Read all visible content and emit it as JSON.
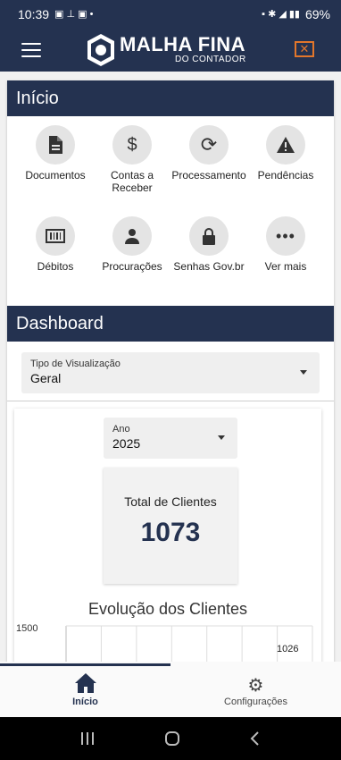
{
  "status_bar": {
    "time": "10:39",
    "battery": "69%"
  },
  "app_bar": {
    "brand_title": "MALHA FINA",
    "brand_subtitle": "DO CONTADOR"
  },
  "inicio": {
    "title": "Início",
    "tiles": [
      {
        "label": "Documentos",
        "icon": "document-icon"
      },
      {
        "label": "Contas a Receber",
        "icon": "dollar-icon"
      },
      {
        "label": "Processamento",
        "icon": "sync-icon"
      },
      {
        "label": "Pendências",
        "icon": "warning-icon"
      },
      {
        "label": "Débitos",
        "icon": "barcode-icon"
      },
      {
        "label": "Procurações",
        "icon": "person-icon"
      },
      {
        "label": "Senhas Gov.br",
        "icon": "lock-icon"
      },
      {
        "label": "Ver mais",
        "icon": "more-icon"
      }
    ]
  },
  "dashboard": {
    "title": "Dashboard",
    "view_type": {
      "label": "Tipo de Visualização",
      "value": "Geral"
    },
    "year": {
      "label": "Ano",
      "value": "2025"
    },
    "total_clients": {
      "label": "Total de Clientes",
      "value": "1073"
    },
    "chart_title": "Evolução dos Clientes"
  },
  "chart_data": {
    "type": "bar",
    "title": "Evolução dos Clientes",
    "y_tick_top": "1500",
    "visible_value_label": "1026",
    "ylim": [
      0,
      1500
    ],
    "grid": true
  },
  "bottom_nav": {
    "home_label": "Início",
    "config_label": "Configurações"
  }
}
